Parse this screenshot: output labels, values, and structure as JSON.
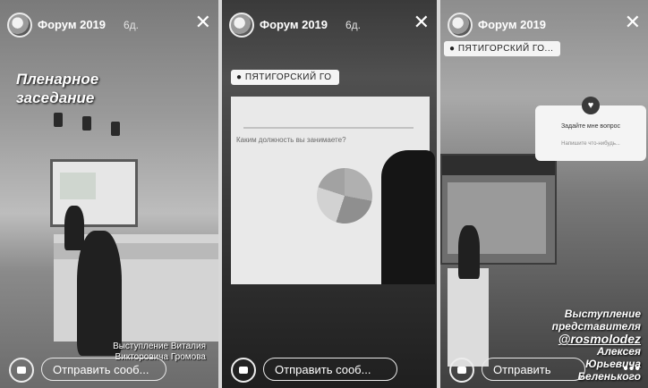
{
  "stories": [
    {
      "account": "Форум 2019",
      "age": "6д.",
      "caption": [
        "Пленарное",
        "заседание"
      ],
      "bottom_caption": [
        "Выступление Виталия",
        "Викторовича Громова"
      ],
      "reply_placeholder": "Отправить сооб..."
    },
    {
      "account": "Форум 2019",
      "age": "6д.",
      "location": "● ПЯТИГОРСКИЙ ГО",
      "slide_question": "Каким должность вы занимаете?",
      "reply_placeholder": "Отправить сооб..."
    },
    {
      "account": "Форум 2019",
      "age": "",
      "location": "● ПЯТИГОРСКИЙ ГО...",
      "question_sticker": {
        "title": "Задайте мне вопрос",
        "subtitle": "Напишите что-нибудь..."
      },
      "caption": [
        "Выступление",
        "представителя",
        "@rosmolodez",
        "Алексея",
        "Юрьевича",
        "Беленького"
      ],
      "reply_placeholder": "Отправить сооб...",
      "more": "•••"
    }
  ]
}
